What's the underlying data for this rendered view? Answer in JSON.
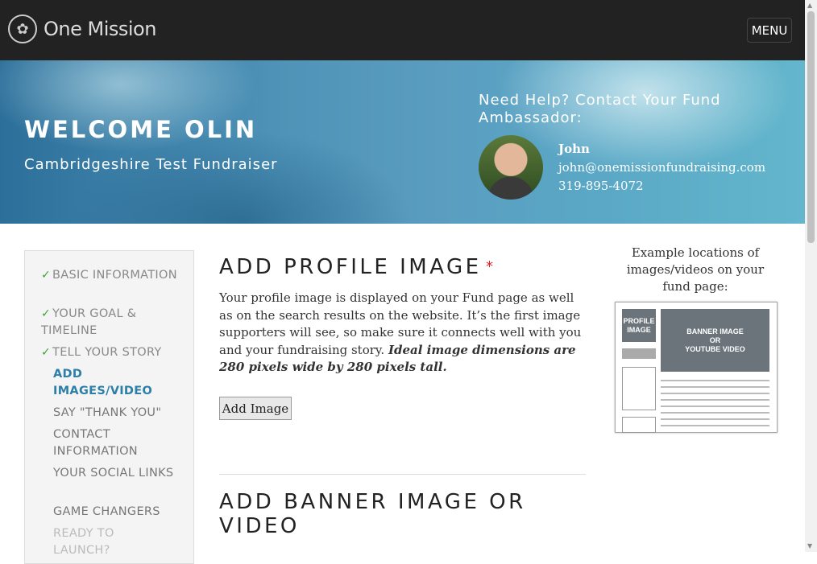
{
  "header": {
    "logo_text": "One Mission",
    "menu_label": "MENU"
  },
  "hero": {
    "welcome": "WELCOME OLIN",
    "fund_name": "Cambridgeshire Test Fundraiser",
    "help_title": "Need Help? Contact Your Fund Ambassador:",
    "ambassador": {
      "name": "John",
      "email": "john@onemissionfundraising.com",
      "phone": "319-895-4072"
    }
  },
  "sidebar": {
    "steps": [
      {
        "label": "BASIC INFORMATION",
        "status": "done"
      },
      {
        "label": "YOUR GOAL & TIMELINE",
        "status": "done"
      },
      {
        "label": "TELL YOUR STORY",
        "status": "done"
      },
      {
        "label": "ADD IMAGES/VIDEO",
        "status": "active"
      },
      {
        "label": "SAY \"THANK YOU\"",
        "status": "todo"
      },
      {
        "label": "CONTACT INFORMATION",
        "status": "todo"
      },
      {
        "label": "YOUR SOCIAL LINKS",
        "status": "todo"
      },
      {
        "label": "GAME CHANGERS",
        "status": "todo"
      },
      {
        "label": "READY TO LAUNCH?",
        "status": "disabled"
      }
    ]
  },
  "main": {
    "profile_heading": "ADD PROFILE IMAGE",
    "required_mark": "*",
    "profile_desc": "Your profile image is displayed on your Fund page as well as on the search results on the website. It’s the first image supporters will see, so make sure it connects well with you and your fundraising story.",
    "profile_desc_emphasis": "Ideal image dimensions are 280 pixels wide by 280 pixels tall.",
    "add_image_label": "Add Image",
    "banner_heading": "ADD BANNER IMAGE OR VIDEO"
  },
  "example": {
    "label": "Example locations of images/videos on your fund page:",
    "profile_block": "PROFILE IMAGE",
    "banner_block_line1": "BANNER IMAGE",
    "banner_block_line2": "OR",
    "banner_block_line3": "YOUTUBE VIDEO"
  },
  "icons": {
    "check": "checkmark-icon",
    "logo": "one-mission-logo-icon"
  }
}
